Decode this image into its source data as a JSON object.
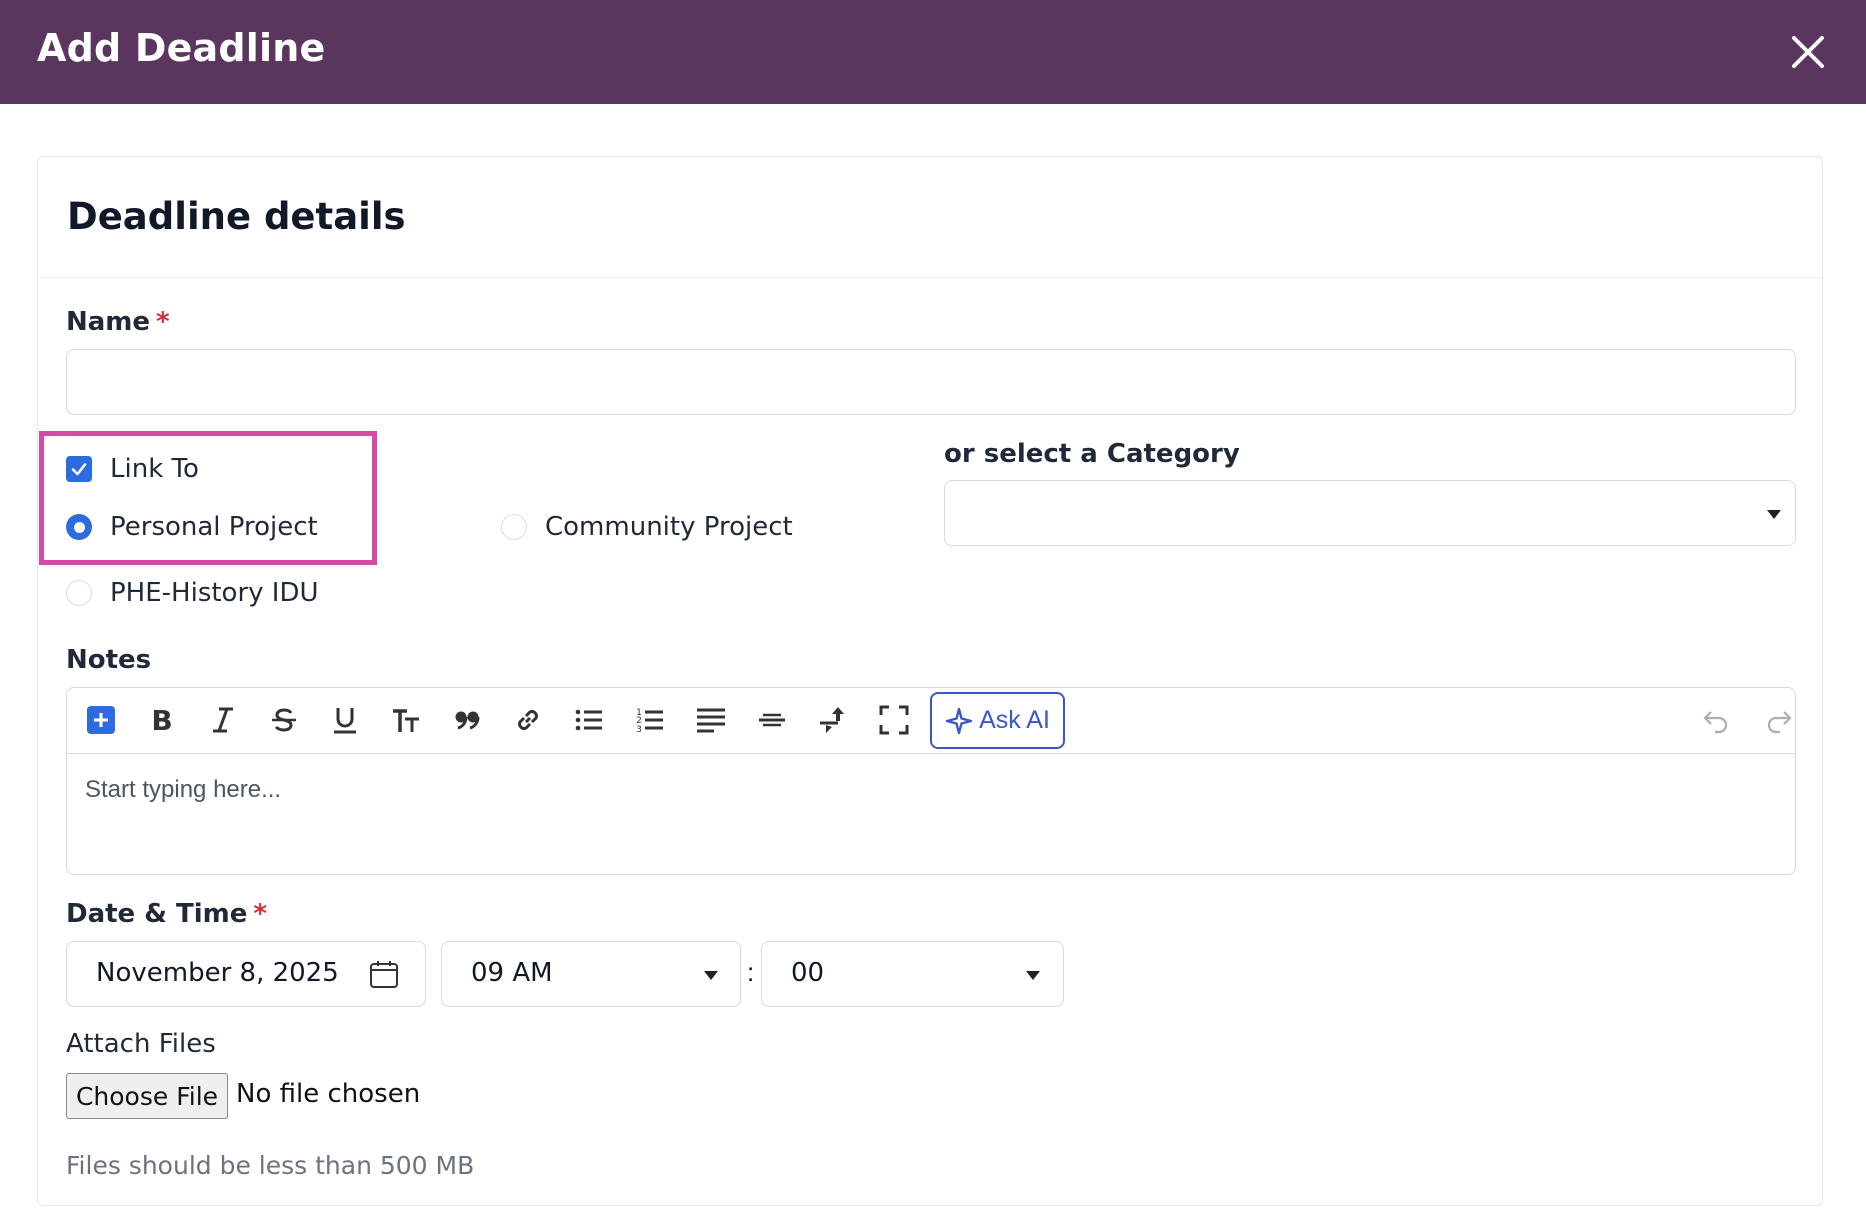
{
  "header": {
    "title": "Add Deadline"
  },
  "card": {
    "title": "Deadline details"
  },
  "name_field": {
    "label": "Name",
    "required_mark": "*",
    "value": ""
  },
  "link": {
    "checkbox_label": "Link To",
    "options": [
      {
        "label": "Personal Project",
        "selected": true
      },
      {
        "label": "Community Project",
        "selected": false
      },
      {
        "label": "PHE-History IDU",
        "selected": false
      }
    ]
  },
  "category": {
    "label": "or select a Category",
    "value": ""
  },
  "notes": {
    "label": "Notes",
    "placeholder": "Start typing here...",
    "ask_ai_label": "Ask AI",
    "toolbar_icons": [
      "add-block-icon",
      "bold-icon",
      "italic-icon",
      "strikethrough-icon",
      "underline-icon",
      "text-size-icon",
      "quote-icon",
      "link-icon",
      "bullet-list-icon",
      "numbered-list-icon",
      "align-icon",
      "horizontal-rule-icon",
      "insert-icon",
      "fullscreen-icon",
      "sparkle-icon",
      "undo-icon",
      "redo-icon"
    ]
  },
  "datetime": {
    "label": "Date & Time",
    "required_mark": "*",
    "date": "November 8, 2025",
    "hour": "09 AM",
    "separator": ":",
    "minute": "00"
  },
  "attach": {
    "label": "Attach Files",
    "button_label": "Choose File",
    "status": "No file chosen",
    "hint": "Files should be less than 500 MB"
  },
  "colors": {
    "header_bg": "#5a355e",
    "accent": "#2c6be0",
    "highlight": "#d54aa6",
    "ask_ai": "#3a56c8",
    "required": "#d0303a"
  }
}
